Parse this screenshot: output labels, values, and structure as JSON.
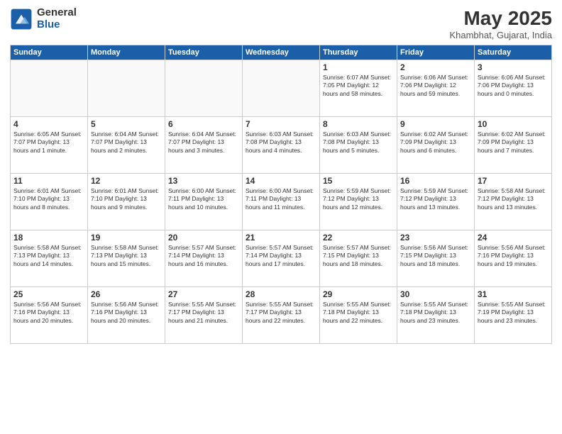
{
  "logo": {
    "general": "General",
    "blue": "Blue"
  },
  "title": "May 2025",
  "location": "Khambhat, Gujarat, India",
  "days_of_week": [
    "Sunday",
    "Monday",
    "Tuesday",
    "Wednesday",
    "Thursday",
    "Friday",
    "Saturday"
  ],
  "weeks": [
    [
      {
        "day": "",
        "info": ""
      },
      {
        "day": "",
        "info": ""
      },
      {
        "day": "",
        "info": ""
      },
      {
        "day": "",
        "info": ""
      },
      {
        "day": "1",
        "info": "Sunrise: 6:07 AM\nSunset: 7:05 PM\nDaylight: 12 hours\nand 58 minutes."
      },
      {
        "day": "2",
        "info": "Sunrise: 6:06 AM\nSunset: 7:06 PM\nDaylight: 12 hours\nand 59 minutes."
      },
      {
        "day": "3",
        "info": "Sunrise: 6:06 AM\nSunset: 7:06 PM\nDaylight: 13 hours\nand 0 minutes."
      }
    ],
    [
      {
        "day": "4",
        "info": "Sunrise: 6:05 AM\nSunset: 7:07 PM\nDaylight: 13 hours\nand 1 minute."
      },
      {
        "day": "5",
        "info": "Sunrise: 6:04 AM\nSunset: 7:07 PM\nDaylight: 13 hours\nand 2 minutes."
      },
      {
        "day": "6",
        "info": "Sunrise: 6:04 AM\nSunset: 7:07 PM\nDaylight: 13 hours\nand 3 minutes."
      },
      {
        "day": "7",
        "info": "Sunrise: 6:03 AM\nSunset: 7:08 PM\nDaylight: 13 hours\nand 4 minutes."
      },
      {
        "day": "8",
        "info": "Sunrise: 6:03 AM\nSunset: 7:08 PM\nDaylight: 13 hours\nand 5 minutes."
      },
      {
        "day": "9",
        "info": "Sunrise: 6:02 AM\nSunset: 7:09 PM\nDaylight: 13 hours\nand 6 minutes."
      },
      {
        "day": "10",
        "info": "Sunrise: 6:02 AM\nSunset: 7:09 PM\nDaylight: 13 hours\nand 7 minutes."
      }
    ],
    [
      {
        "day": "11",
        "info": "Sunrise: 6:01 AM\nSunset: 7:10 PM\nDaylight: 13 hours\nand 8 minutes."
      },
      {
        "day": "12",
        "info": "Sunrise: 6:01 AM\nSunset: 7:10 PM\nDaylight: 13 hours\nand 9 minutes."
      },
      {
        "day": "13",
        "info": "Sunrise: 6:00 AM\nSunset: 7:11 PM\nDaylight: 13 hours\nand 10 minutes."
      },
      {
        "day": "14",
        "info": "Sunrise: 6:00 AM\nSunset: 7:11 PM\nDaylight: 13 hours\nand 11 minutes."
      },
      {
        "day": "15",
        "info": "Sunrise: 5:59 AM\nSunset: 7:12 PM\nDaylight: 13 hours\nand 12 minutes."
      },
      {
        "day": "16",
        "info": "Sunrise: 5:59 AM\nSunset: 7:12 PM\nDaylight: 13 hours\nand 13 minutes."
      },
      {
        "day": "17",
        "info": "Sunrise: 5:58 AM\nSunset: 7:12 PM\nDaylight: 13 hours\nand 13 minutes."
      }
    ],
    [
      {
        "day": "18",
        "info": "Sunrise: 5:58 AM\nSunset: 7:13 PM\nDaylight: 13 hours\nand 14 minutes."
      },
      {
        "day": "19",
        "info": "Sunrise: 5:58 AM\nSunset: 7:13 PM\nDaylight: 13 hours\nand 15 minutes."
      },
      {
        "day": "20",
        "info": "Sunrise: 5:57 AM\nSunset: 7:14 PM\nDaylight: 13 hours\nand 16 minutes."
      },
      {
        "day": "21",
        "info": "Sunrise: 5:57 AM\nSunset: 7:14 PM\nDaylight: 13 hours\nand 17 minutes."
      },
      {
        "day": "22",
        "info": "Sunrise: 5:57 AM\nSunset: 7:15 PM\nDaylight: 13 hours\nand 18 minutes."
      },
      {
        "day": "23",
        "info": "Sunrise: 5:56 AM\nSunset: 7:15 PM\nDaylight: 13 hours\nand 18 minutes."
      },
      {
        "day": "24",
        "info": "Sunrise: 5:56 AM\nSunset: 7:16 PM\nDaylight: 13 hours\nand 19 minutes."
      }
    ],
    [
      {
        "day": "25",
        "info": "Sunrise: 5:56 AM\nSunset: 7:16 PM\nDaylight: 13 hours\nand 20 minutes."
      },
      {
        "day": "26",
        "info": "Sunrise: 5:56 AM\nSunset: 7:16 PM\nDaylight: 13 hours\nand 20 minutes."
      },
      {
        "day": "27",
        "info": "Sunrise: 5:55 AM\nSunset: 7:17 PM\nDaylight: 13 hours\nand 21 minutes."
      },
      {
        "day": "28",
        "info": "Sunrise: 5:55 AM\nSunset: 7:17 PM\nDaylight: 13 hours\nand 22 minutes."
      },
      {
        "day": "29",
        "info": "Sunrise: 5:55 AM\nSunset: 7:18 PM\nDaylight: 13 hours\nand 22 minutes."
      },
      {
        "day": "30",
        "info": "Sunrise: 5:55 AM\nSunset: 7:18 PM\nDaylight: 13 hours\nand 23 minutes."
      },
      {
        "day": "31",
        "info": "Sunrise: 5:55 AM\nSunset: 7:19 PM\nDaylight: 13 hours\nand 23 minutes."
      }
    ]
  ]
}
